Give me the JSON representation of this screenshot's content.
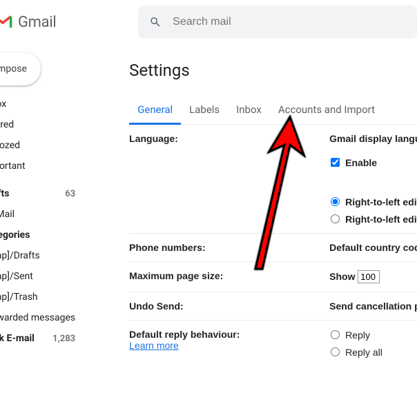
{
  "header": {
    "brand": "Gmail",
    "search_placeholder": "Search mail"
  },
  "sidebar": {
    "compose_label": "Compose",
    "items": [
      {
        "label": "Inbox",
        "count": ""
      },
      {
        "label": "Starred",
        "count": ""
      },
      {
        "label": "Snoozed",
        "count": ""
      },
      {
        "label": "Important",
        "count": ""
      }
    ],
    "categories": [
      {
        "label": "Drafts",
        "count": "63",
        "bold": true
      },
      {
        "label": "All Mail",
        "count": ""
      },
      {
        "label": "Categories",
        "count": "",
        "bold": true
      },
      {
        "label": "[Imap]/Drafts",
        "count": ""
      },
      {
        "label": "[Imap]/Sent",
        "count": ""
      },
      {
        "label": "[Imap]/Trash",
        "count": ""
      },
      {
        "label": "Forwarded messages",
        "count": ""
      },
      {
        "label": "Junk E-mail",
        "count": "1,283",
        "bold": true
      }
    ]
  },
  "settings": {
    "title": "Settings",
    "tabs": [
      "General",
      "Labels",
      "Inbox",
      "Accounts and Import"
    ],
    "rows": {
      "language": {
        "label": "Language:",
        "display_label": "Gmail display language:",
        "enable_label": "Enable",
        "rtl_on": "Right-to-left editing on",
        "rtl_off": "Right-to-left editing off"
      },
      "phone": {
        "label": "Phone numbers:",
        "value_label": "Default country code:"
      },
      "pagesize": {
        "label": "Maximum page size:",
        "show_label": "Show",
        "value": "100"
      },
      "undo": {
        "label": "Undo Send:",
        "value_label": "Send cancellation period:"
      },
      "reply": {
        "label": "Default reply behaviour:",
        "learn": "Learn more",
        "opt1": "Reply",
        "opt2": "Reply all"
      }
    }
  }
}
